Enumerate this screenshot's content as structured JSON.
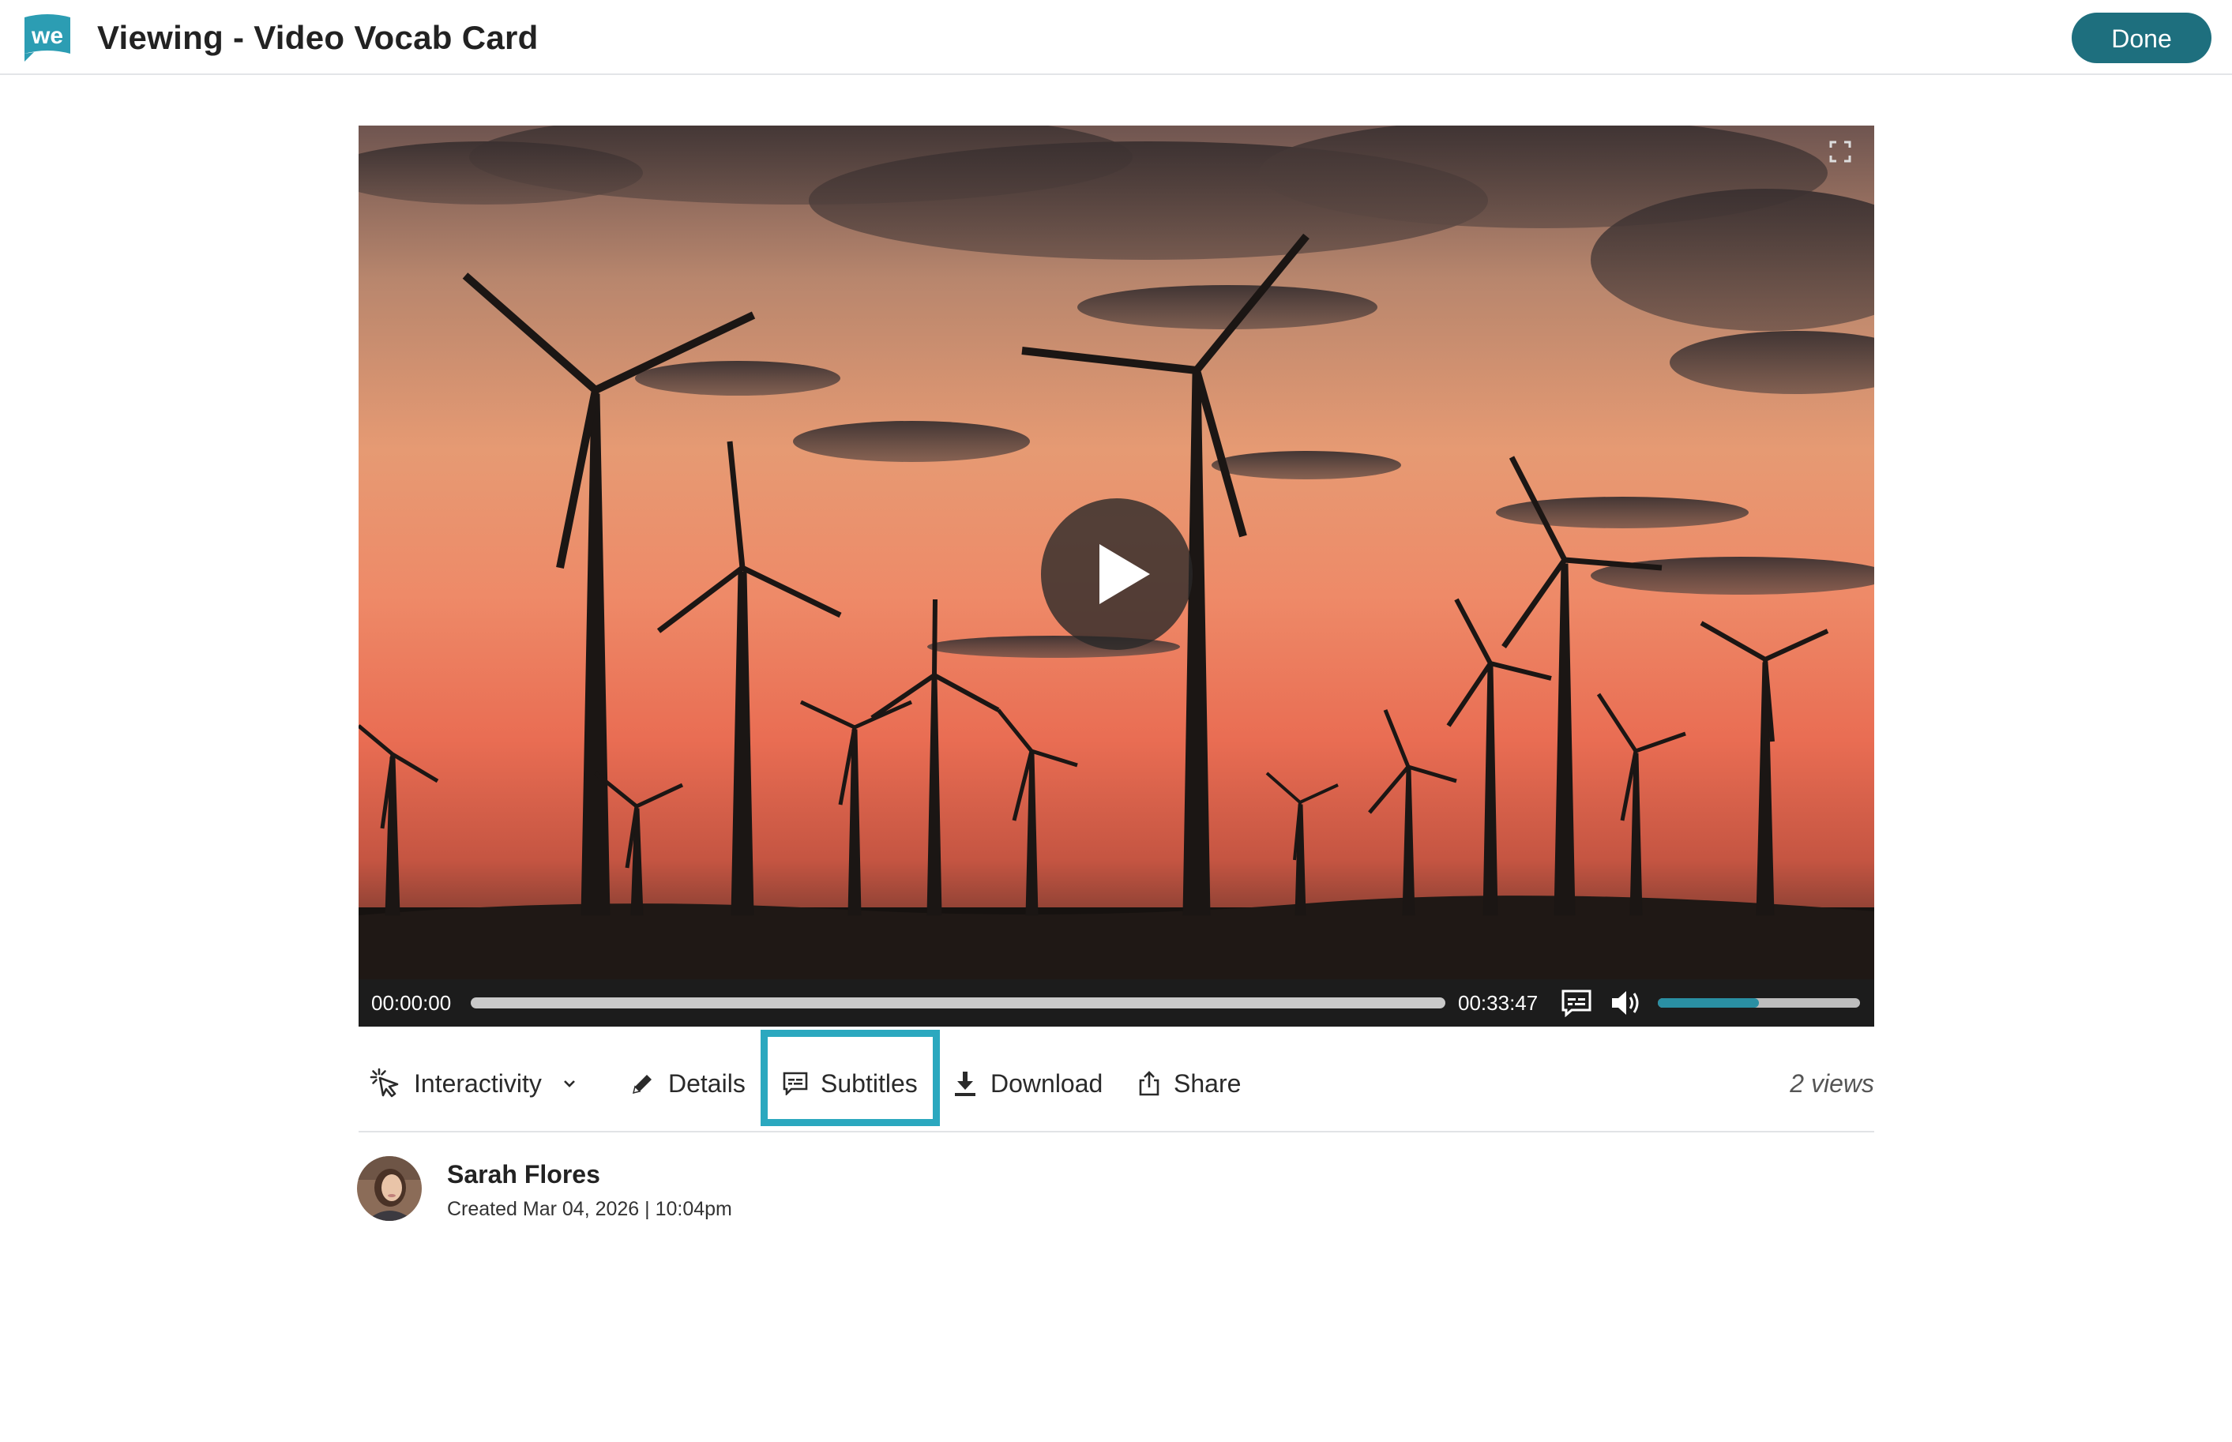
{
  "header": {
    "logo_text": "we",
    "title": "Viewing - Video Vocab Card",
    "done_label": "Done"
  },
  "video": {
    "current_time": "00:00:00",
    "total_time": "00:33:47",
    "progress": 0.0,
    "volume": 0.5,
    "icons": [
      "fullscreen-icon",
      "play-icon",
      "captions-icon",
      "volume-icon"
    ]
  },
  "toolbar": {
    "interactivity_label": "Interactivity",
    "details_label": "Details",
    "subtitles_label": "Subtitles",
    "download_label": "Download",
    "share_label": "Share",
    "views": "2 views",
    "highlighted_item": "subtitles"
  },
  "author": {
    "name": "Sarah Flores",
    "created": "Created Mar 04, 2026 | 10:04pm"
  },
  "colors": {
    "brand": "#1e6f7e",
    "accent": "#2a8fa3",
    "highlight": "#2ba8bf"
  }
}
